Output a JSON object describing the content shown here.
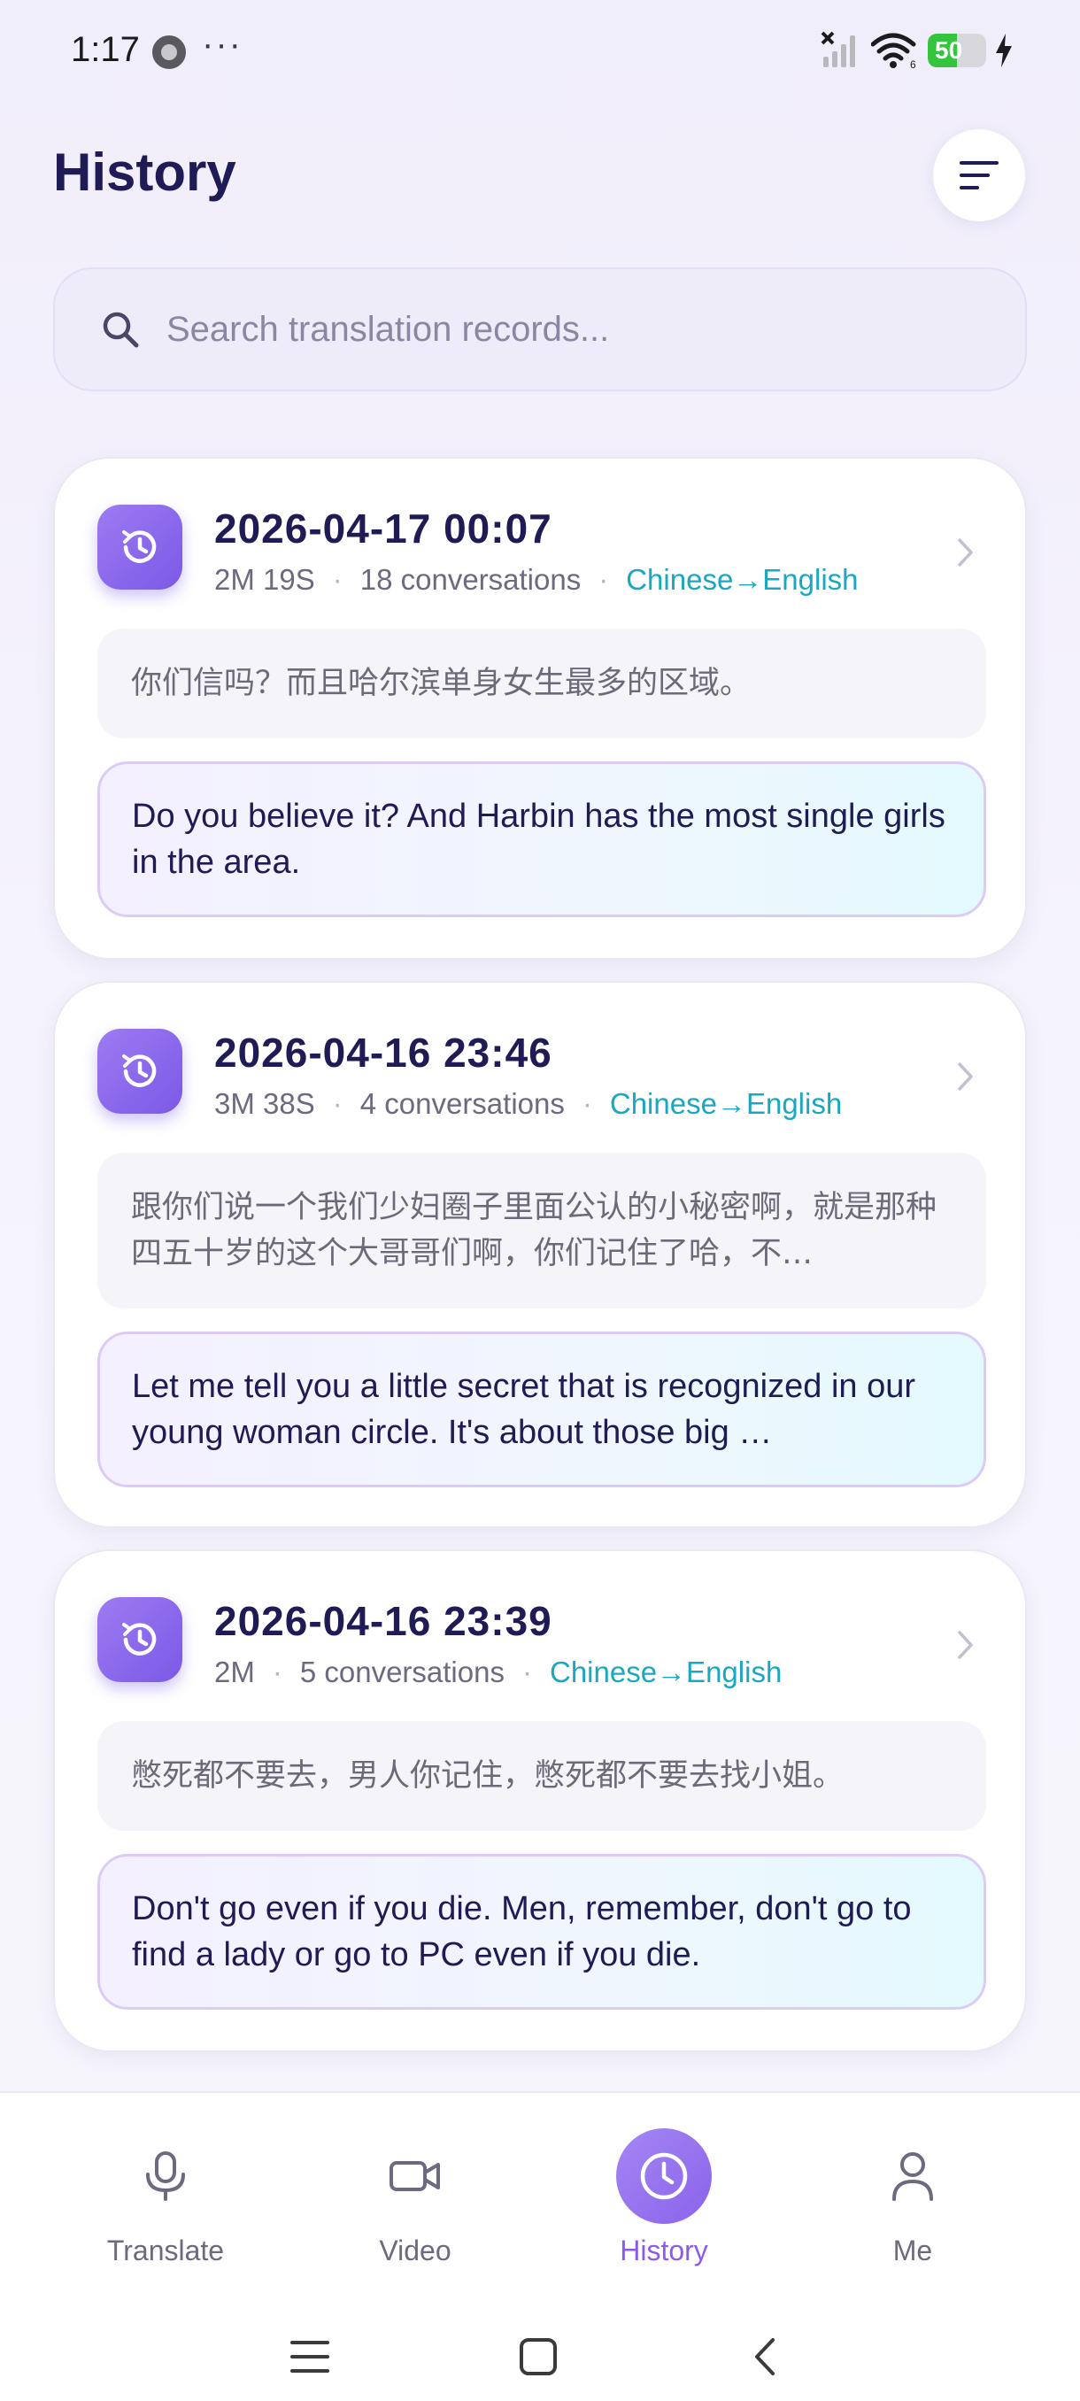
{
  "status_bar": {
    "time": "1:17",
    "dots": "···",
    "battery": "50",
    "battery_level_percent": 50,
    "battery_color": "#35c43d"
  },
  "header": {
    "title": "History",
    "sort_icon": "sort-lines-icon"
  },
  "search": {
    "placeholder": "Search translation records..."
  },
  "records": [
    {
      "datetime": "2026-04-17 00:07",
      "duration": "2M 19S",
      "conversations": "18 conversations",
      "languages": "Chinese→English",
      "source": "你们信吗？而且哈尔滨单身女生最多的区域。",
      "translation": "Do you believe it? And Harbin has the most single girls in the area."
    },
    {
      "datetime": "2026-04-16 23:46",
      "duration": "3M 38S",
      "conversations": "4 conversations",
      "languages": "Chinese→English",
      "source": "跟你们说一个我们少妇圈子里面公认的小秘密啊，就是那种四五十岁的这个大哥哥们啊，你们记住了哈，不…",
      "translation": "Let me tell you a little secret that is recognized in our young woman circle. It's about those big …"
    },
    {
      "datetime": "2026-04-16 23:39",
      "duration": "2M",
      "conversations": "5 conversations",
      "languages": "Chinese→English",
      "source": "憋死都不要去，男人你记住，憋死都不要去找小姐。",
      "translation": "Don't go even if you die. Men, remember, don't go to find a lady or go to PC even if you die."
    }
  ],
  "nav": {
    "items": [
      {
        "label": "Translate",
        "icon": "microphone-icon"
      },
      {
        "label": "Video",
        "icon": "video-camera-icon"
      },
      {
        "label": "History",
        "icon": "clock-icon"
      },
      {
        "label": "Me",
        "icon": "person-icon"
      }
    ],
    "active": "History",
    "accent_color": "#8c5ce9"
  },
  "colors": {
    "title": "#1e1b55",
    "language_tag": "#19a7c2",
    "card_icon": "#8a68ea"
  }
}
